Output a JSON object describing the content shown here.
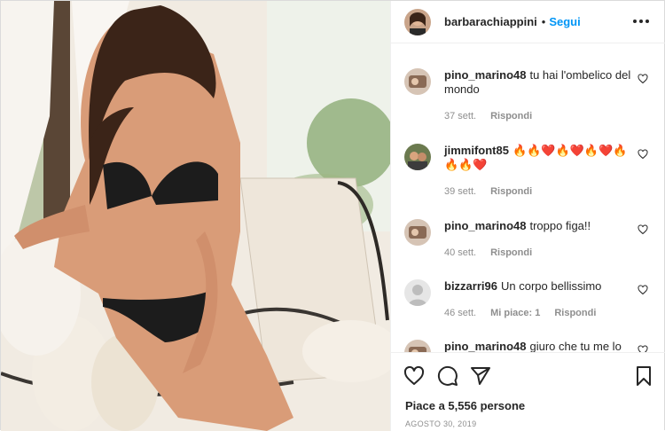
{
  "post": {
    "username": "barbarachiappini",
    "separator": "•",
    "follow_label": "Segui",
    "more_icon": "more-horizontal-icon"
  },
  "comments": [
    {
      "user": "pino_marino48",
      "text": "tu hai l'ombelico del mondo",
      "time": "37 sett.",
      "likes": "",
      "reply": "Rispondi"
    },
    {
      "user": "jimmifont85",
      "text": "🔥🔥❤️🔥❤️🔥❤️🔥🔥🔥❤️",
      "time": "39 sett.",
      "likes": "",
      "reply": "Rispondi"
    },
    {
      "user": "pino_marino48",
      "text": "troppo figa!!",
      "time": "40 sett.",
      "likes": "",
      "reply": "Rispondi"
    },
    {
      "user": "bizzarri96",
      "text": "Un corpo bellissimo",
      "time": "46 sett.",
      "likes": "Mi piace: 1",
      "reply": "Rispondi"
    },
    {
      "user": "pino_marino48",
      "text": "giuro che tu  me lo",
      "time": "",
      "likes": "",
      "reply": ""
    }
  ],
  "actions": {
    "like_icon": "heart-icon",
    "comment_icon": "comment-icon",
    "share_icon": "share-icon",
    "save_icon": "bookmark-icon"
  },
  "likes_text": "Piace a 5,556 persone",
  "date_text": "AGOSTO 30, 2019",
  "colors": {
    "link": "#0095f6",
    "muted": "#8e8e8e",
    "text": "#262626",
    "border": "#efefef"
  }
}
